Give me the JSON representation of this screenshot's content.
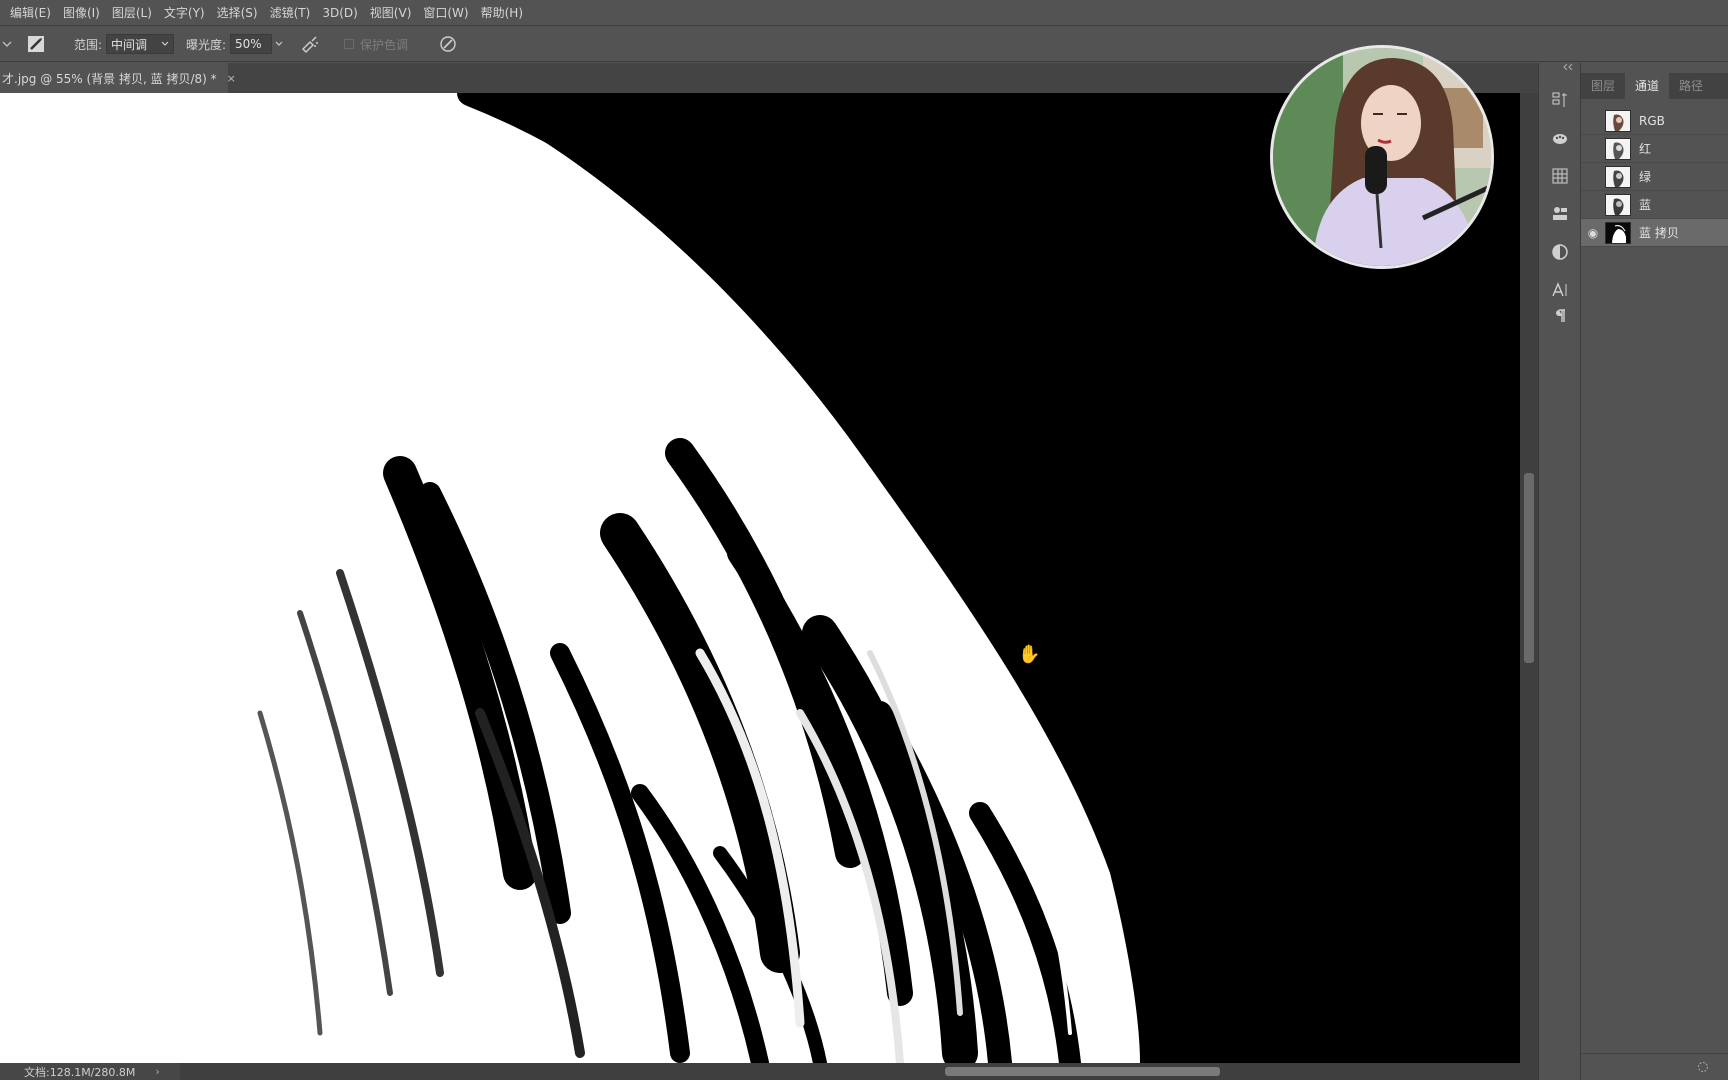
{
  "menubar": {
    "items": [
      "编辑(E)",
      "图像(I)",
      "图层(L)",
      "文字(Y)",
      "选择(S)",
      "滤镜(T)",
      "3D(D)",
      "视图(V)",
      "窗口(W)",
      "帮助(H)"
    ]
  },
  "options": {
    "range_label": "范围:",
    "range_value": "中间调",
    "exposure_label": "曝光度:",
    "exposure_value": "50%",
    "protect_tones_label": "保护色调"
  },
  "document": {
    "tab_title": "才.jpg @ 55% (背景 拷贝, 蓝 拷贝/8) *",
    "close_glyph": "×"
  },
  "status": {
    "doc_info": "文档:128.1M/280.8M",
    "arrow": "›"
  },
  "panel": {
    "tabs": [
      "图层",
      "通道",
      "路径"
    ],
    "active_tab": "通道",
    "channels": [
      {
        "name": "RGB",
        "visible": false,
        "selected": false
      },
      {
        "name": "红",
        "visible": false,
        "selected": false
      },
      {
        "name": "绿",
        "visible": false,
        "selected": false
      },
      {
        "name": "蓝",
        "visible": false,
        "selected": false
      },
      {
        "name": "蓝 拷贝",
        "visible": true,
        "selected": true
      }
    ]
  },
  "icons": {
    "eye": "◉",
    "hand_cursor": "✋"
  },
  "colors": {
    "ui_bg": "#535353",
    "canvas_bg": "#000000",
    "mask_white": "#ffffff"
  }
}
